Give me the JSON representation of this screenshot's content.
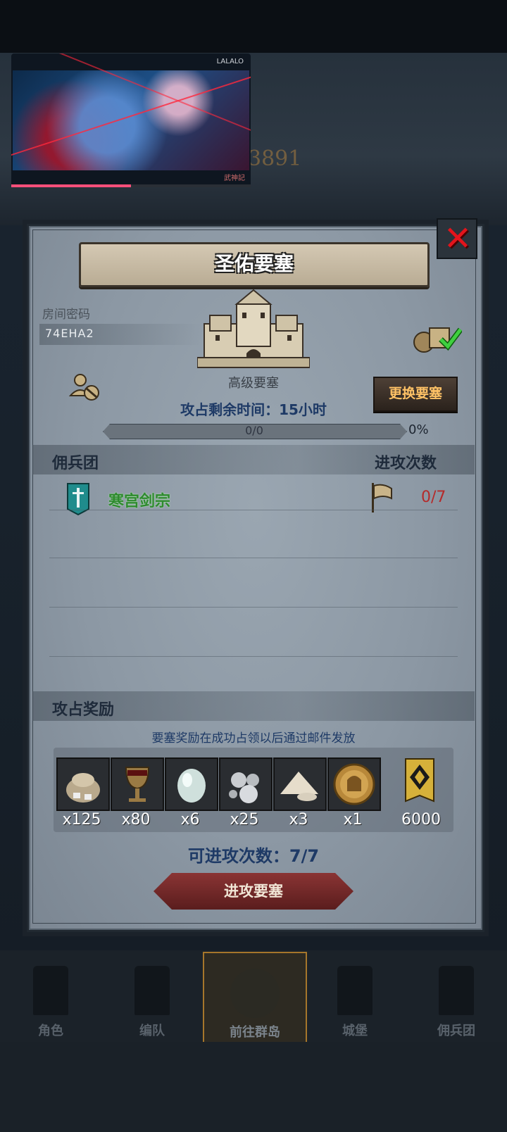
{
  "video": {
    "watermark_top": "LALALO",
    "watermark_bottom": "武神記",
    "progress_percent": 50
  },
  "background": {
    "number": "3891"
  },
  "panel": {
    "title": "圣佑要塞",
    "close_icon": "close-icon",
    "room": {
      "label": "房间密码",
      "code": "74EHA2"
    },
    "fortress": {
      "level": "高级要塞",
      "change_button": "更换要塞",
      "timer_label": "攻占剩余时间：15小时",
      "progress": {
        "current": 0,
        "total": 0,
        "text": "0/0",
        "percent": "0%"
      }
    },
    "mercenaries": {
      "title": "佣兵团",
      "attacks_header": "进攻次数",
      "rows": [
        {
          "name": "寒宫剑宗",
          "attacks": "0/7"
        }
      ]
    },
    "rewards": {
      "title": "攻占奖励",
      "note": "要塞奖励在成功占领以后通过邮件发放",
      "items": [
        {
          "icon": "ore-sack-icon",
          "count": "x125"
        },
        {
          "icon": "goblet-icon",
          "count": "x80"
        },
        {
          "icon": "pearl-stone-icon",
          "count": "x6"
        },
        {
          "icon": "silver-nuggets-icon",
          "count": "x25"
        },
        {
          "icon": "salt-pile-icon",
          "count": "x3"
        },
        {
          "icon": "knight-coin-icon",
          "count": "x1"
        },
        {
          "icon": "guild-rank-icon",
          "count": "6000"
        }
      ]
    },
    "available_attacks": "可进攻次数：7/7",
    "attack_button": "进攻要塞"
  },
  "nav": {
    "items": [
      {
        "label": "角色",
        "icon": "knight-icon"
      },
      {
        "label": "编队",
        "icon": "helmet-icon"
      },
      {
        "label": "前往群岛",
        "icon": "compass-icon",
        "active": true
      },
      {
        "label": "城堡",
        "icon": "castle-icon"
      },
      {
        "label": "佣兵团",
        "icon": "tower-icon"
      }
    ]
  },
  "colors": {
    "panel_bg": "#8c98a4",
    "guild_name": "#2e8b2e",
    "attack_count": "#b52a2a",
    "change_button_text": "#ffc266",
    "progress_bar_fill": "#ff4f7a"
  }
}
